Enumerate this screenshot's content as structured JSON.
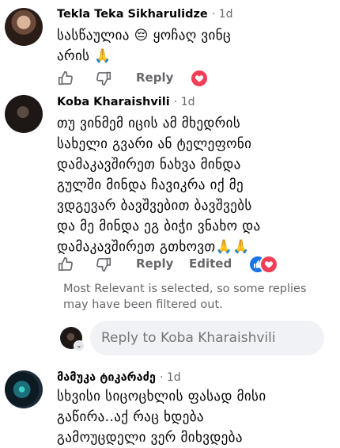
{
  "comments": [
    {
      "author": "Tekla Teka Sikharulidze",
      "time": "1d",
      "lines": [
        "სასწაულია 😔 ყოჩაღ ვინც",
        "არის 🙏"
      ],
      "reply_label": "Reply",
      "reactions": [
        "love"
      ]
    },
    {
      "author": "Koba Kharaishvili",
      "time": "1d",
      "lines": [
        "თუ ვინმემ იცის ამ მხედრის",
        "სახელი გვარი ან ტელეფონი",
        "დამაკავშირეთ ნახვა მინდა",
        "გულში მინდა ჩავიკრა იქ მე",
        "ვდგევარ ბავშვებით ბავშვებს",
        "და მე მინდა ეგ ბიჭი ვნახო და",
        "დამაკავშირეთ გთხოვთ🙏🙏"
      ],
      "reply_label": "Reply",
      "edited_label": "Edited",
      "reactions": [
        "like",
        "love"
      ]
    },
    {
      "author": "მამუკა ტიკარაძე",
      "time": "1d",
      "lines": [
        "სხვისი სიცოცხლის ფასად მისი",
        "გაწირა..აქ რაც ხდება",
        "გამოუცდელი ვერ მიხვდება"
      ]
    }
  ],
  "notice": "Most Relevant is selected, so some replies may have been filtered out.",
  "reply_input": {
    "placeholder": "Reply to Koba Kharaishvili"
  },
  "colors": {
    "love": "#f33e58",
    "like": "#1b74e4",
    "secondary_text": "#65676b",
    "input_bg": "#f0f2f5"
  }
}
